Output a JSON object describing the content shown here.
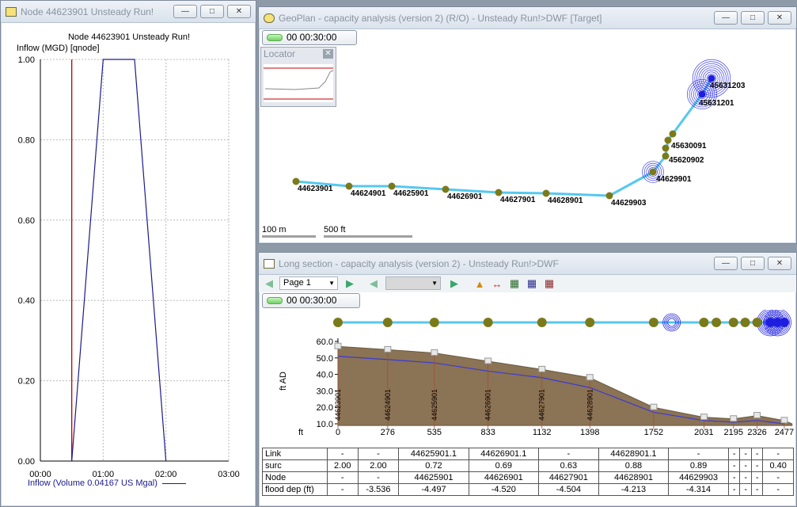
{
  "node_window": {
    "title": "Node 44623901 Unsteady Run!",
    "chart_title": "Node 44623901 Unsteady Run!",
    "ylabel": "Inflow (MGD) [qnode]",
    "legend": "Inflow (Volume 0.04167 US Mgal)"
  },
  "chart_data": {
    "type": "line",
    "title": "Node 44623901 Unsteady Run!",
    "ylabel": "Inflow (MGD) [qnode]",
    "xlabel": "",
    "x_ticks": [
      "00:00",
      "01:00",
      "02:00",
      "03:00"
    ],
    "y_ticks": [
      "0.00",
      "0.20",
      "0.40",
      "0.60",
      "0.80",
      "1.00"
    ],
    "xlim": [
      0,
      180
    ],
    "ylim": [
      0,
      1
    ],
    "current_time_minutes": 30,
    "series": [
      {
        "name": "Inflow (Volume 0.04167 US Mgal)",
        "color": "#1b1b8c",
        "x": [
          30,
          60,
          90,
          120
        ],
        "y": [
          0.0,
          1.0,
          1.0,
          0.0
        ]
      }
    ]
  },
  "geoplan": {
    "title": "GeoPlan - capacity analysis (version 2) (R/O) - Unsteady Run!>DWF  [Target]",
    "time": "00 00:30:00",
    "locator_title": "Locator",
    "scale_100": "100 m",
    "scale_500": "500 ft",
    "nodes": [
      "44623901",
      "44624901",
      "44625901",
      "44626901",
      "44627901",
      "44628901",
      "44629903",
      "44629901",
      "45620902",
      "45630091",
      "45631201",
      "45631203"
    ]
  },
  "long_section": {
    "title": "Long section - capacity analysis (version 2) - Unsteady Run!>DWF",
    "page_value": "Page 1",
    "time": "00 00:30:00",
    "ylabel": "ft AD",
    "y_ticks": [
      "60.0",
      "50.0",
      "40.0",
      "30.0",
      "20.0",
      "10.0"
    ],
    "x_unit": "ft",
    "x_ticks": [
      "0",
      "276",
      "535",
      "833",
      "1132",
      "1398",
      "1752",
      "2031",
      "2195",
      "2326",
      "2477"
    ],
    "section_labels": [
      "44623901",
      "44624901",
      "44625901",
      "44626901",
      "44627901",
      "44628901"
    ],
    "table": {
      "row1_label": "Link",
      "row2_label": "surc",
      "row3_label": "Node",
      "row4_label": "flood dep (ft)",
      "links": [
        "-",
        "-",
        "44625901.1",
        "44626901.1",
        "-",
        "44628901.1",
        "-",
        "-",
        "-",
        "-",
        "-"
      ],
      "surc": [
        "2.00",
        "2.00",
        "0.72",
        "0.69",
        "0.63",
        "0.88",
        "0.89",
        "-",
        "-",
        "-",
        "0.40"
      ],
      "nodes": [
        "-",
        "-",
        "44625901",
        "44626901",
        "44627901",
        "44628901",
        "44629903",
        "-",
        "-",
        "-",
        "-"
      ],
      "flood": [
        "-",
        "-3.536",
        "-4.497",
        "-4.520",
        "-4.504",
        "-4.213",
        "-4.314",
        "-",
        "-",
        "-",
        "-"
      ]
    }
  },
  "colors": {
    "ground": "#8b7355",
    "hgl": "#3a3ad6",
    "pipe": "#55c8f0",
    "node": "#7b7a1a",
    "surcharge_ring": "#2a2ae0",
    "time_line": "#c00000"
  }
}
